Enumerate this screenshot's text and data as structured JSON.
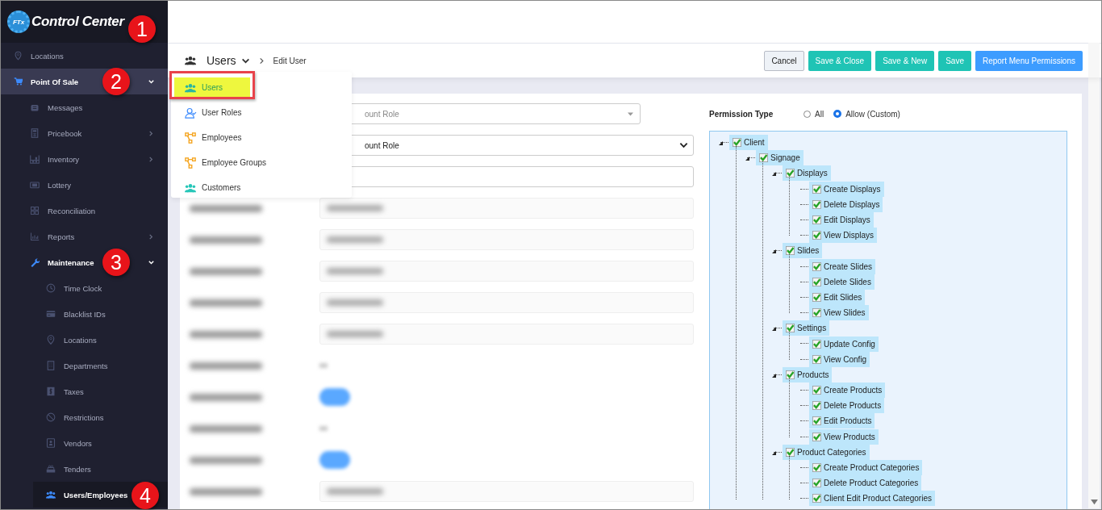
{
  "sidebar": {
    "logo": {
      "text": "Control Center",
      "badge": "FTx",
      "marker": "1"
    },
    "items": [
      {
        "label": "Locations",
        "selected": false
      },
      {
        "label": "Point Of Sale",
        "selected": true,
        "expanded": true,
        "marker": "2",
        "children": [
          {
            "label": "Messages",
            "selected": false
          },
          {
            "label": "Pricebook",
            "selected": false,
            "has_submenu": true
          },
          {
            "label": "Inventory",
            "selected": false,
            "has_submenu": true
          },
          {
            "label": "Lottery",
            "selected": false
          },
          {
            "label": "Reconciliation",
            "selected": false
          },
          {
            "label": "Reports",
            "selected": false,
            "has_submenu": true
          },
          {
            "label": "Maintenance",
            "selected": true,
            "expanded": true,
            "marker": "3",
            "children": [
              {
                "label": "Time Clock",
                "selected": false
              },
              {
                "label": "Blacklist IDs",
                "selected": false
              },
              {
                "label": "Locations",
                "selected": false
              },
              {
                "label": "Departments",
                "selected": false
              },
              {
                "label": "Taxes",
                "selected": false
              },
              {
                "label": "Restrictions",
                "selected": false
              },
              {
                "label": "Vendors",
                "selected": false
              },
              {
                "label": "Tenders",
                "selected": false
              },
              {
                "label": "Users/Employees",
                "selected": true,
                "marker": "4"
              }
            ]
          }
        ]
      }
    ]
  },
  "header": {
    "breadcrumb": {
      "section": "Users",
      "current": "Edit User"
    },
    "buttons": [
      {
        "label": "Cancel",
        "kind": "default"
      },
      {
        "label": "Save & Close",
        "kind": "teal"
      },
      {
        "label": "Save & New",
        "kind": "teal"
      },
      {
        "label": "Save",
        "kind": "teal"
      },
      {
        "label": "Report Menu Permissions",
        "kind": "blue"
      }
    ]
  },
  "section_menu": {
    "items": [
      {
        "label": "Users",
        "selected": true
      },
      {
        "label": "User Roles",
        "selected": false
      },
      {
        "label": "Employees",
        "selected": false
      },
      {
        "label": "Employee Groups",
        "selected": false
      },
      {
        "label": "Customers",
        "selected": false
      }
    ]
  },
  "form": {
    "fields": [
      {
        "kind": "select",
        "value": "ount Role"
      },
      {
        "kind": "dropdown",
        "value": "ount Role"
      },
      {
        "kind": "text"
      },
      {
        "kind": "blurred-field"
      },
      {
        "kind": "blurred-field"
      },
      {
        "kind": "blurred-field"
      },
      {
        "kind": "blurred-field"
      },
      {
        "kind": "blurred-field"
      },
      {
        "kind": "blurred-blank"
      },
      {
        "kind": "blurred-toggle",
        "on": true
      },
      {
        "kind": "blurred-blank"
      },
      {
        "kind": "blurred-toggle",
        "on": true
      },
      {
        "kind": "blurred-select"
      }
    ]
  },
  "permissions": {
    "label": "Permission Type",
    "options": [
      {
        "label": "All",
        "selected": false
      },
      {
        "label": "Allow (Custom)",
        "selected": true
      }
    ],
    "tree": [
      {
        "label": "Client",
        "checked": true,
        "children": [
          {
            "label": "Signage",
            "checked": true,
            "children": [
              {
                "label": "Displays",
                "checked": true,
                "children": [
                  {
                    "label": "Create Displays",
                    "checked": true
                  },
                  {
                    "label": "Delete Displays",
                    "checked": true
                  },
                  {
                    "label": "Edit Displays",
                    "checked": true
                  },
                  {
                    "label": "View Displays",
                    "checked": true
                  }
                ]
              },
              {
                "label": "Slides",
                "checked": true,
                "children": [
                  {
                    "label": "Create Slides",
                    "checked": true
                  },
                  {
                    "label": "Delete Slides",
                    "checked": true
                  },
                  {
                    "label": "Edit Slides",
                    "checked": true
                  },
                  {
                    "label": "View Slides",
                    "checked": true
                  }
                ]
              },
              {
                "label": "Settings",
                "checked": true,
                "children": [
                  {
                    "label": "Update Config",
                    "checked": true
                  },
                  {
                    "label": "View Config",
                    "checked": true
                  }
                ]
              },
              {
                "label": "Products",
                "checked": true,
                "children": [
                  {
                    "label": "Create Products",
                    "checked": true
                  },
                  {
                    "label": "Delete Products",
                    "checked": true
                  },
                  {
                    "label": "Edit Products",
                    "checked": true
                  },
                  {
                    "label": "View Products",
                    "checked": true
                  }
                ]
              },
              {
                "label": "Product Categories",
                "checked": true,
                "children": [
                  {
                    "label": "Create Product Categories",
                    "checked": true
                  },
                  {
                    "label": "Delete Product Categories",
                    "checked": true
                  },
                  {
                    "label": "Client Edit Product Categories",
                    "checked": true
                  }
                ]
              }
            ]
          }
        ]
      }
    ]
  }
}
